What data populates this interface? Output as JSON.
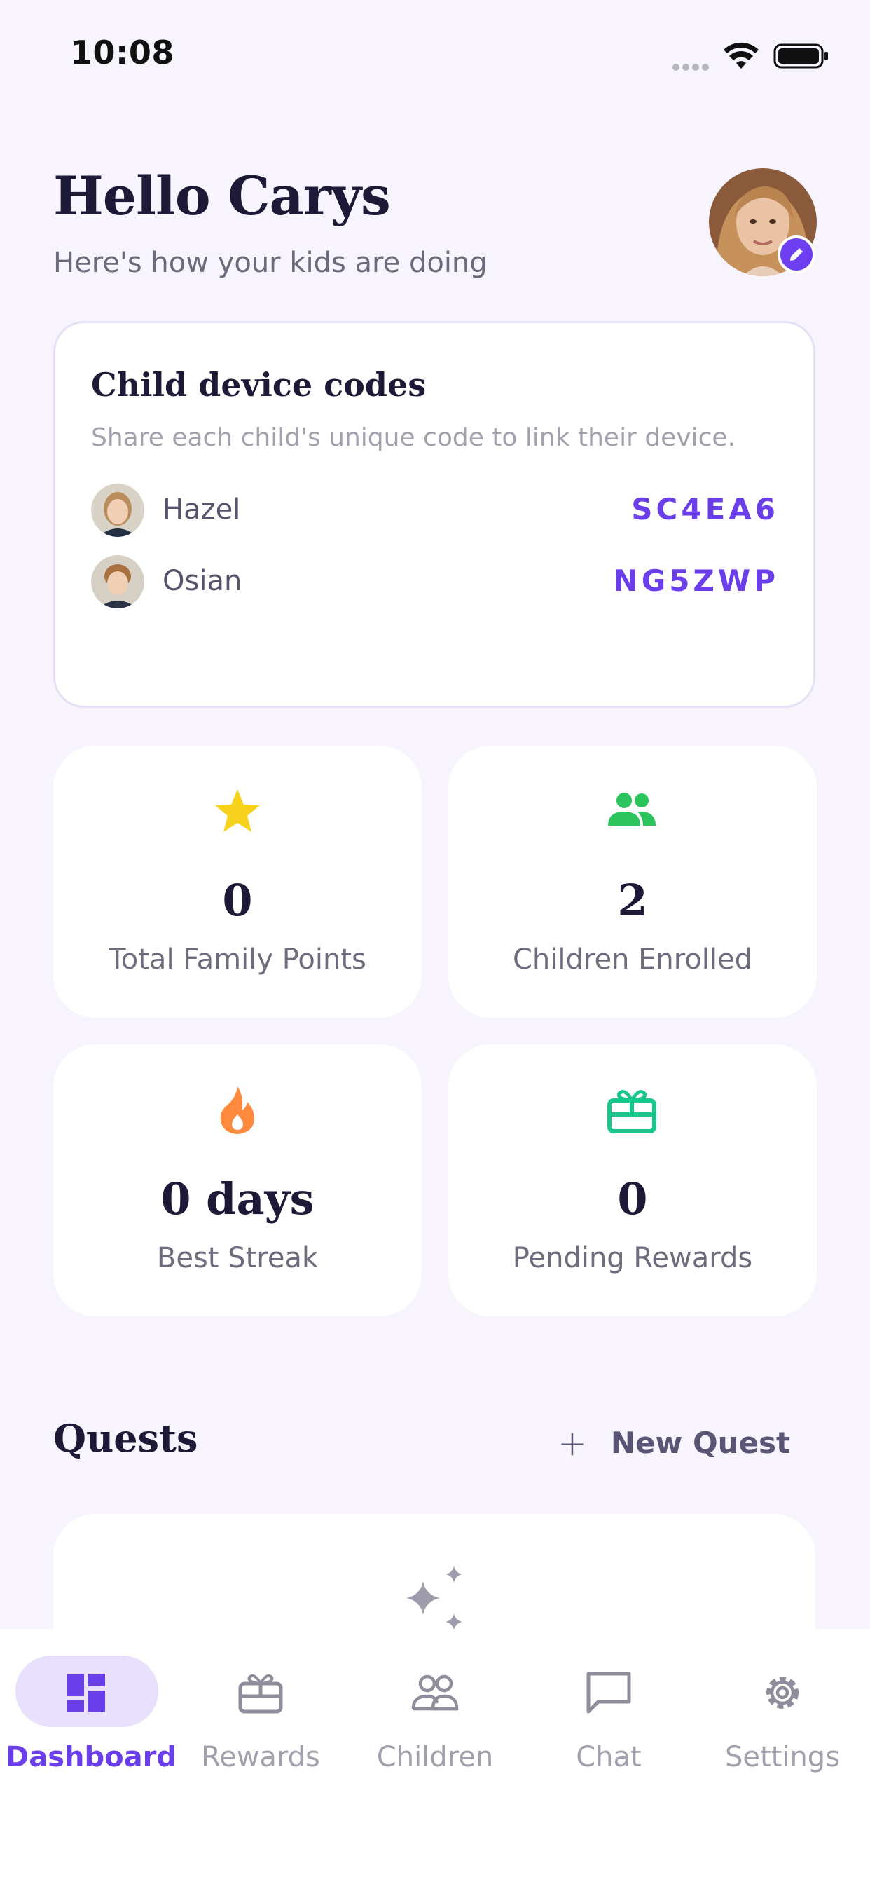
{
  "status_bar": {
    "time": "10:08"
  },
  "header": {
    "greeting": "Hello Carys",
    "subtitle": "Here's how your kids are doing",
    "avatar_icon": "profile-photo",
    "edit_icon": "pencil-icon"
  },
  "device_codes": {
    "title": "Child device codes",
    "description": "Share each child's unique code to link their device.",
    "children": [
      {
        "name": "Hazel",
        "code": "SC4EA6"
      },
      {
        "name": "Osian",
        "code": "NG5ZWP"
      }
    ]
  },
  "stats": [
    {
      "icon": "star-icon",
      "value": "0",
      "label": "Total Family Points",
      "color": "#f7d21c"
    },
    {
      "icon": "group-icon",
      "value": "2",
      "label": "Children Enrolled",
      "color": "#2bc45c"
    },
    {
      "icon": "flame-icon",
      "value": "0 days",
      "label": "Best Streak",
      "color": "#ff8a3d"
    },
    {
      "icon": "gift-icon",
      "value": "0",
      "label": "Pending Rewards",
      "color": "#19c78e"
    }
  ],
  "quests": {
    "title": "Quests",
    "new_quest_label": "New Quest",
    "empty_icon": "sparkle-icon"
  },
  "tab_bar": {
    "active": "Dashboard",
    "tabs": [
      {
        "label": "Dashboard",
        "icon": "dashboard-icon"
      },
      {
        "label": "Rewards",
        "icon": "gift-icon"
      },
      {
        "label": "Children",
        "icon": "children-icon"
      },
      {
        "label": "Chat",
        "icon": "chat-icon"
      },
      {
        "label": "Settings",
        "icon": "gear-icon"
      }
    ]
  },
  "colors": {
    "accent": "#6a3ee8",
    "background": "#f7f4fe",
    "active_tab_pill": "#e8e0fd"
  }
}
